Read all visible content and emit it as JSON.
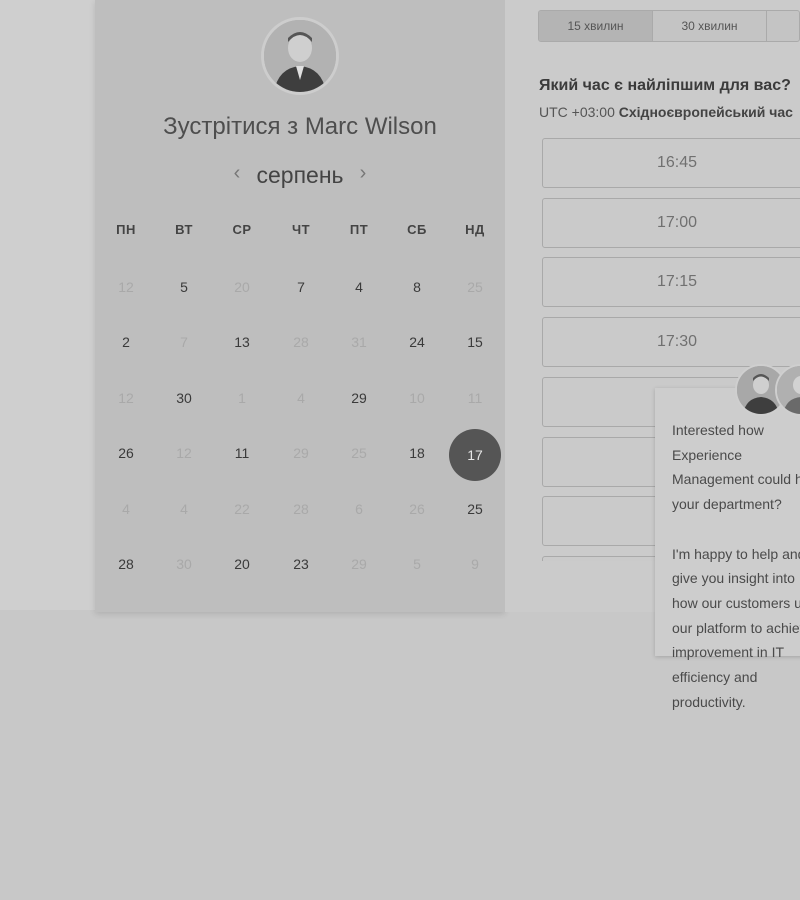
{
  "host": {
    "title_prefix": "Зустрітися з",
    "name": "Marc Wilson"
  },
  "calendar": {
    "month": "серпень",
    "prev_icon": "chevron-left-icon",
    "next_icon": "chevron-right-icon",
    "weekdays": [
      "ПН",
      "ВТ",
      "СР",
      "ЧТ",
      "ПТ",
      "СБ",
      "НД"
    ],
    "weeks": [
      [
        {
          "d": "12",
          "m": true
        },
        {
          "d": "5"
        },
        {
          "d": "20",
          "m": true
        },
        {
          "d": "7"
        },
        {
          "d": "4"
        },
        {
          "d": "8"
        },
        {
          "d": "25",
          "m": true
        }
      ],
      [
        {
          "d": "2"
        },
        {
          "d": "7",
          "m": true
        },
        {
          "d": "13"
        },
        {
          "d": "28",
          "m": true
        },
        {
          "d": "31",
          "m": true
        },
        {
          "d": "24"
        },
        {
          "d": "15"
        }
      ],
      [
        {
          "d": "12",
          "m": true
        },
        {
          "d": "30"
        },
        {
          "d": "1",
          "m": true
        },
        {
          "d": "4",
          "m": true
        },
        {
          "d": "29"
        },
        {
          "d": "10",
          "m": true
        },
        {
          "d": "11",
          "m": true
        }
      ],
      [
        {
          "d": "26"
        },
        {
          "d": "12",
          "m": true
        },
        {
          "d": "11"
        },
        {
          "d": "29",
          "m": true
        },
        {
          "d": "25",
          "m": true
        },
        {
          "d": "18"
        },
        {
          "d": "17",
          "s": true
        }
      ],
      [
        {
          "d": "4",
          "m": true
        },
        {
          "d": "4",
          "m": true
        },
        {
          "d": "22",
          "m": true
        },
        {
          "d": "28",
          "m": true
        },
        {
          "d": "6",
          "m": true
        },
        {
          "d": "26",
          "m": true
        },
        {
          "d": "25"
        }
      ],
      [
        {
          "d": "28"
        },
        {
          "d": "30",
          "m": true
        },
        {
          "d": "20"
        },
        {
          "d": "23"
        },
        {
          "d": "29",
          "m": true
        },
        {
          "d": "5",
          "m": true
        },
        {
          "d": "9",
          "m": true
        }
      ]
    ]
  },
  "durations": [
    "15 хвилин",
    "30 хвилин"
  ],
  "time_question": "Який час є найліпшим для вас?",
  "timezone": {
    "offset": "UTC +03:00",
    "name": "Східноєвропейський час"
  },
  "slots": [
    "16:45",
    "17:00",
    "17:15",
    "17:30",
    "",
    "",
    "",
    ""
  ],
  "chat": {
    "message": "Interested how Experience Management could help your department?\n\nI'm happy to help and give you insight into how our customers use our platform to achieve improvement in IT efficiency and productivity."
  }
}
